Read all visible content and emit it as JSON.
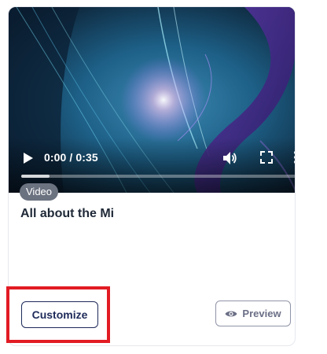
{
  "video": {
    "time_display": "0:00 / 0:35",
    "progress_fraction": 0.1,
    "icons": [
      "play-icon",
      "volume-icon",
      "fullscreen-icon",
      "more-options-icon"
    ]
  },
  "card": {
    "badge": "Video",
    "title": "All about the Mi"
  },
  "actions": {
    "customize_label": "Customize",
    "preview_label": "Preview",
    "preview_icon": "eye-icon"
  },
  "colors": {
    "highlight": "#e21b23",
    "primary_text": "#1e2a5a",
    "badge_bg": "#6b7280"
  }
}
